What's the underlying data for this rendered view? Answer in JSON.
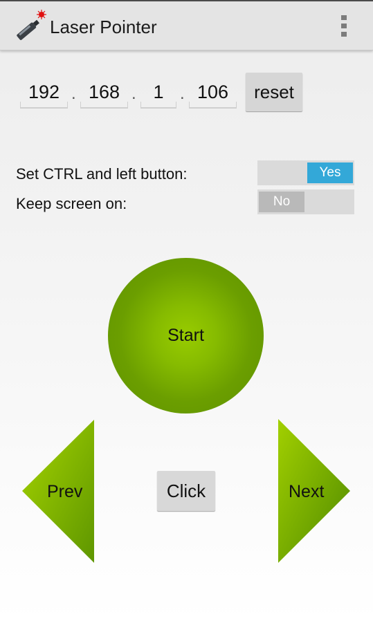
{
  "app": {
    "title": "Laser Pointer",
    "icon": "laser-pointer-icon",
    "menu_icon": "overflow-menu-icon"
  },
  "ip": {
    "octets": [
      "192",
      "168",
      "1",
      "106"
    ],
    "separator": ".",
    "reset_label": "reset"
  },
  "settings": [
    {
      "label": "Set CTRL and left button:",
      "state_label": "Yes",
      "enabled": true
    },
    {
      "label": "Keep screen on:",
      "state_label": "No",
      "enabled": false
    }
  ],
  "controls": {
    "start_label": "Start",
    "prev_label": "Prev",
    "click_label": "Click",
    "next_label": "Next"
  },
  "colors": {
    "toggle_on": "#33a8d8",
    "green_light": "#98cc00",
    "green_dark": "#5e9200"
  }
}
